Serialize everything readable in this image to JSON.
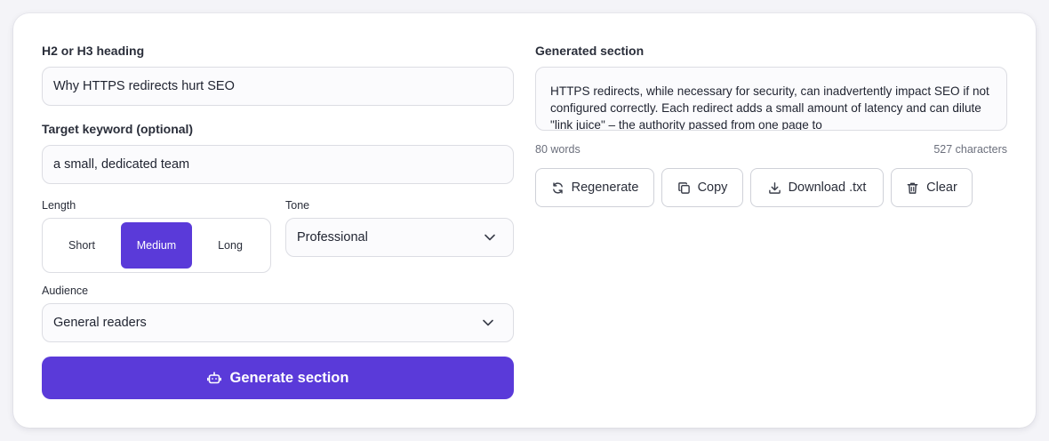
{
  "form": {
    "heading_label": "H2 or H3 heading",
    "heading_value": "Why HTTPS redirects hurt SEO",
    "keyword_label": "Target keyword (optional)",
    "keyword_value": "a small, dedicated team",
    "length_label": "Length",
    "length_options": [
      "Short",
      "Medium",
      "Long"
    ],
    "length_selected": "Medium",
    "tone_label": "Tone",
    "tone_value": "Professional",
    "audience_label": "Audience",
    "audience_value": "General readers",
    "generate_label": "Generate section"
  },
  "output": {
    "label": "Generated section",
    "text": "HTTPS redirects, while necessary for security, can inadvertently impact SEO if not configured correctly. Each redirect adds a small amount of latency and can dilute \"link juice\" – the authority passed from one page to",
    "word_count": "80 words",
    "char_count": "527 characters"
  },
  "actions": {
    "regenerate": "Regenerate",
    "copy": "Copy",
    "download": "Download .txt",
    "clear": "Clear"
  },
  "colors": {
    "accent": "#5a3ad9"
  }
}
